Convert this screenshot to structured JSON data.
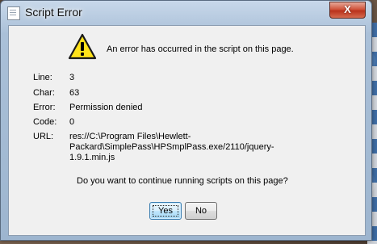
{
  "window": {
    "title": "Script Error",
    "close_label": "X"
  },
  "message": "An error has occurred in the script on this page.",
  "details": {
    "line_label": "Line:",
    "line_value": "3",
    "char_label": "Char:",
    "char_value": "63",
    "error_label": "Error:",
    "error_value": "Permission denied",
    "code_label": "Code:",
    "code_value": "0",
    "url_label": "URL:",
    "url_value": "res://C:\\Program Files\\Hewlett-Packard\\SimplePass\\HPSmplPass.exe/2110/jquery-1.9.1.min.js"
  },
  "question": "Do you want to continue running scripts on this page?",
  "buttons": {
    "yes_label": "Yes",
    "no_label": "No"
  },
  "icons": {
    "title": "script-document-icon",
    "warning": "warning-triangle-icon",
    "close": "close-icon"
  },
  "colors": {
    "warning_fill": "#ffe21a",
    "close_button": "#c8422b",
    "dialog_background": "#f0f0f0"
  }
}
